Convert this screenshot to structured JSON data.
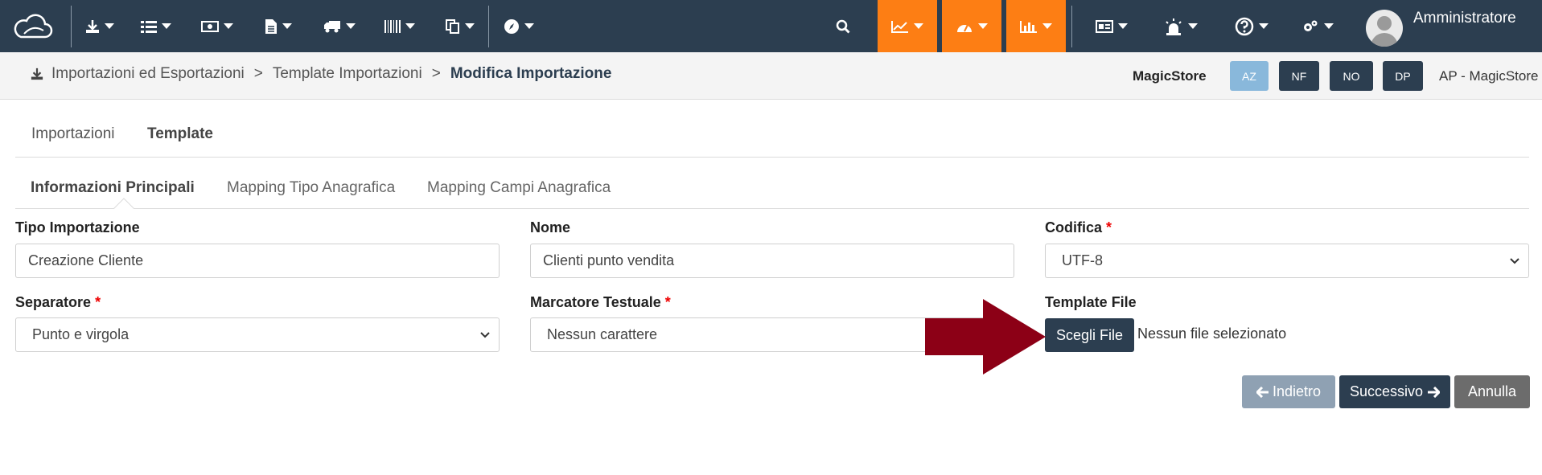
{
  "nav": {
    "icons": [
      "cloud-logo-icon",
      "download-icon",
      "list-icon",
      "money-icon",
      "document-icon",
      "truck-icon",
      "barcode-icon",
      "copy-icon",
      "compass-icon",
      "search-icon",
      "line-chart-icon",
      "dashboard-icon",
      "bar-chart-icon",
      "id-card-icon",
      "alarm-icon",
      "help-icon",
      "gears-icon"
    ],
    "user_name": "Amministratore",
    "accent_color": "#fd7e14",
    "bg_color": "#2c3e50"
  },
  "breadcrumb": {
    "items": [
      "Importazioni ed Esportazioni",
      "Template Importazioni",
      "Modifica Importazione"
    ],
    "separator": ">"
  },
  "store": {
    "name": "MagicStore",
    "badges": [
      "AZ",
      "NF",
      "NO",
      "DP"
    ],
    "full_label": "AP - MagicStore"
  },
  "tabs": [
    "Importazioni",
    "Template"
  ],
  "subtabs": [
    "Informazioni Principali",
    "Mapping Tipo Anagrafica",
    "Mapping Campi Anagrafica"
  ],
  "form": {
    "tipo_importazione": {
      "label": "Tipo Importazione",
      "value": "Creazione Cliente"
    },
    "nome": {
      "label": "Nome",
      "value": "Clienti punto vendita"
    },
    "codifica": {
      "label": "Codifica",
      "required": "*",
      "value": "UTF-8"
    },
    "separatore": {
      "label": "Separatore",
      "required": "*",
      "value": "Punto e virgola"
    },
    "marcatore": {
      "label": "Marcatore Testuale",
      "required": "*",
      "value": "Nessun carattere"
    },
    "template_file": {
      "label": "Template File",
      "button": "Scegli File",
      "status": "Nessun file selezionato"
    }
  },
  "actions": {
    "back": "Indietro",
    "next": "Successivo",
    "cancel": "Annulla"
  }
}
